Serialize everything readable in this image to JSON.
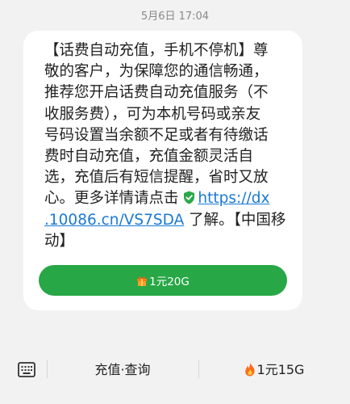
{
  "header": {
    "timestamp": "5月6日 17:04"
  },
  "message": {
    "lines": [
      "【话费自动充值，手机不停机】尊",
      "敬的客户，为保障您的通信畅通，",
      "推荐您开启话费自动充值服务（不",
      "收服务费），可为本机号码或亲友",
      "号码设置当余额不足或者有待缴话",
      "费时自动充值，充值金额灵活自",
      "选，充值后有短信提醒，省时又放"
    ],
    "line8_prefix": "心。更多详情请点击 ",
    "link_part1": "https://dx",
    "link_part2": ".10086.cn/VS7SDA",
    "line9_suffix": " 了解。【中国移",
    "line10": "动】",
    "shield_icon": "verified-shield-icon",
    "link_color": "#1a7ad6"
  },
  "cta": {
    "label": "1元20G",
    "icon": "gift-icon",
    "color": "#27a745"
  },
  "bottom_menu": {
    "keyboard_icon": "keyboard-icon",
    "item1": "充值·查询",
    "item2": "1元15G",
    "item2_icon": "fire-icon"
  }
}
